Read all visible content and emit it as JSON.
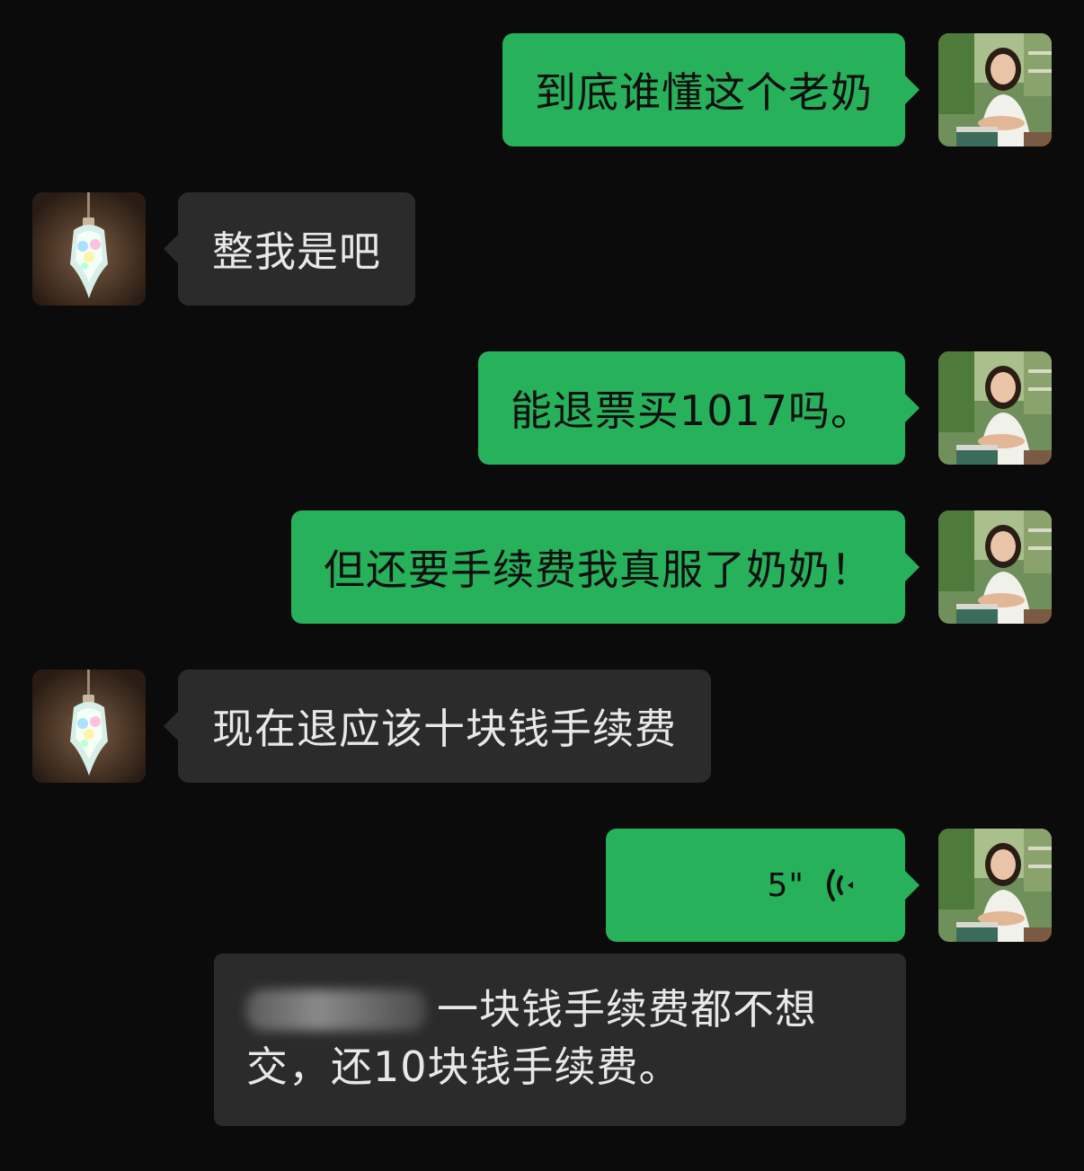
{
  "chat": {
    "messages": [
      {
        "from": "me",
        "text": "到底谁懂这个老奶"
      },
      {
        "from": "peer",
        "text": "整我是吧"
      },
      {
        "from": "me",
        "text": "能退票买1017吗。"
      },
      {
        "from": "me",
        "text": "但还要手续费我真服了奶奶！"
      },
      {
        "from": "peer",
        "text": "现在退应该十块钱手续费"
      },
      {
        "from": "me",
        "type": "voice",
        "duration": "5\""
      }
    ],
    "transcript": {
      "line1_visible": "一块钱手续费都不想",
      "line2": "交，还10块钱手续费。"
    }
  },
  "colors": {
    "me_bubble": "#27b15b",
    "peer_bubble": "#2b2b2b",
    "background": "#0b0b0b"
  },
  "icons": {
    "voice": "voice-wave-icon",
    "me_avatar": "avatar-woman-photo",
    "peer_avatar": "avatar-lamp-photo"
  }
}
